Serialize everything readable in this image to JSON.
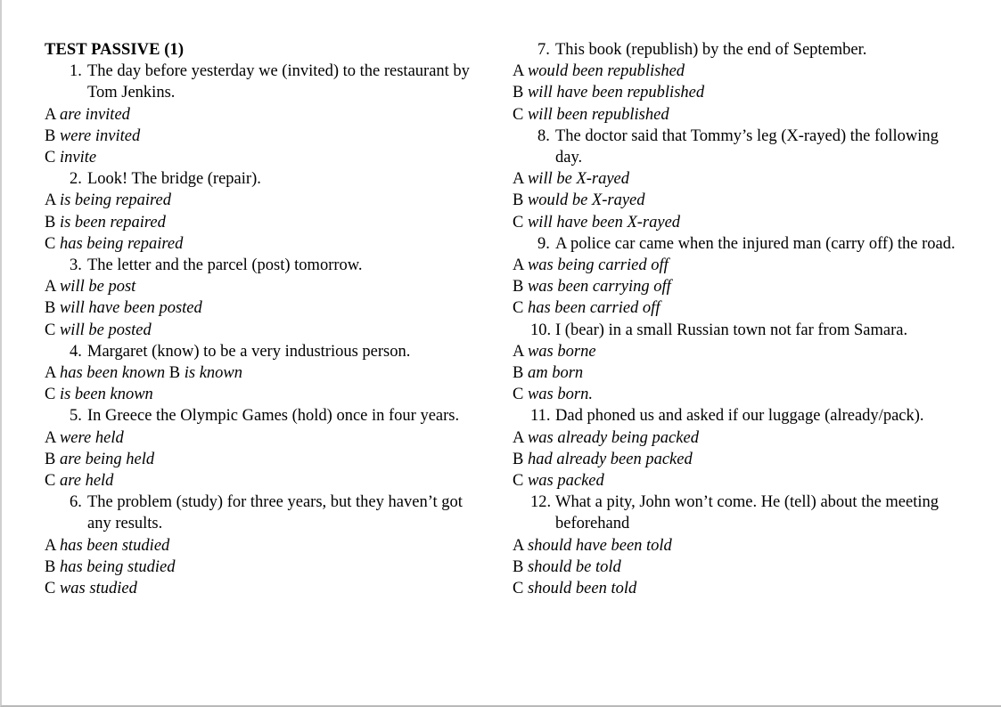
{
  "document": {
    "title": "TEST PASSIVE (1)",
    "columns": [
      {
        "name": "left-column",
        "questions": [
          {
            "number": "1.",
            "text": "The day before yesterday we (invited) to the restaurant by Tom Jenkins.",
            "options": [
              {
                "letter": "A",
                "text": "are invited"
              },
              {
                "letter": "B",
                "text": "were invited"
              },
              {
                "letter": "C",
                "text": "invite"
              }
            ]
          },
          {
            "number": "2.",
            "text": "Look! The bridge (repair).",
            "options": [
              {
                "letter": "A",
                "text": "is being repaired"
              },
              {
                "letter": "B",
                "text": "is been repaired"
              },
              {
                "letter": "C",
                "text": "has being repaired"
              }
            ]
          },
          {
            "number": "3.",
            "text": "The letter and the parcel (post) tomorrow.",
            "options": [
              {
                "letter": "A",
                "text": "will be post"
              },
              {
                "letter": "B",
                "text": "will have been posted"
              },
              {
                "letter": "C",
                "text": "will be posted"
              }
            ]
          },
          {
            "number": "4.",
            "text": "Margaret (know) to be a very industrious person.",
            "options": [
              {
                "letter": "A",
                "text": "has been known",
                "inline_next": {
                  "letter": "B",
                  "text": "is known"
                }
              },
              {
                "letter": "C",
                "text": "is been known"
              }
            ]
          },
          {
            "number": "5.",
            "text": "In Greece the Olympic Games (hold) once in four years.",
            "options": [
              {
                "letter": "A",
                "text": "were held"
              },
              {
                "letter": "B",
                "text": "are being held"
              },
              {
                "letter": "C",
                "text": "are held"
              }
            ]
          },
          {
            "number": "6.",
            "text": "The problem (study) for three years, but they haven’t got any results.",
            "options": [
              {
                "letter": "A",
                "text": "has been studied"
              },
              {
                "letter": "B",
                "text": "has being studied"
              },
              {
                "letter": "C",
                "text": "was studied"
              }
            ]
          }
        ]
      },
      {
        "name": "right-column",
        "questions": [
          {
            "number": "7.",
            "text": "This book (republish) by the end of September.",
            "options": [
              {
                "letter": "A",
                "text": "would been republished"
              },
              {
                "letter": "B",
                "text": "will have been republished"
              },
              {
                "letter": "C",
                "text": "will been republished"
              }
            ]
          },
          {
            "number": "8.",
            "text": "The doctor said that Tommy’s leg (X-rayed) the following day.",
            "options": [
              {
                "letter": "A",
                "text": "will be X-rayed"
              },
              {
                "letter": "B",
                "text": "would be X-rayed"
              },
              {
                "letter": "C",
                "text": "will have been X-rayed"
              }
            ]
          },
          {
            "number": "9.",
            "text": "A police car came when the injured man (carry off) the road.",
            "options": [
              {
                "letter": "A",
                "text": "was being carried off"
              },
              {
                "letter": "B",
                "text": "was been carrying off"
              },
              {
                "letter": "C",
                "text": "has been carried off"
              }
            ]
          },
          {
            "number": "10.",
            "wide": true,
            "text": "I (bear) in a small Russian town not far from Samara.",
            "options": [
              {
                "letter": "A",
                "text": "was borne"
              },
              {
                "letter": "B",
                "text": "am born"
              },
              {
                "letter": "C",
                "text": "was born."
              }
            ]
          },
          {
            "number": "11.",
            "wide": true,
            "text": "Dad phoned us and asked if our luggage (already/pack).",
            "options": [
              {
                "letter": "A",
                "text": "was already being packed"
              },
              {
                "letter": "B",
                "text": "had already been packed"
              },
              {
                "letter": "C",
                "text": "was packed"
              }
            ]
          },
          {
            "number": "12.",
            "wide": true,
            "text": "What a pity, John won’t come. He (tell) about the meeting beforehand",
            "options": [
              {
                "letter": "A",
                "text": "should have been told"
              },
              {
                "letter": "B",
                "text": "should be told"
              },
              {
                "letter": "C",
                "text": "should been told"
              }
            ]
          }
        ]
      }
    ]
  }
}
